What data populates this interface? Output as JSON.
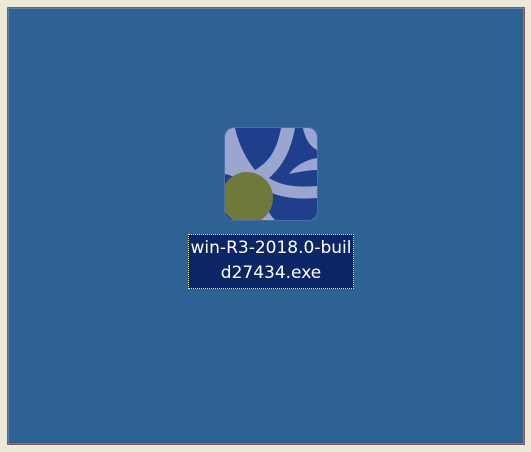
{
  "desktop": {
    "background_color": "#2e6295",
    "icon": {
      "icon_name": "rstudio-installer-icon",
      "label": "win-R3-2018.0-build27434.exe",
      "selected": true,
      "label_highlight_color": "#0b2667"
    }
  }
}
